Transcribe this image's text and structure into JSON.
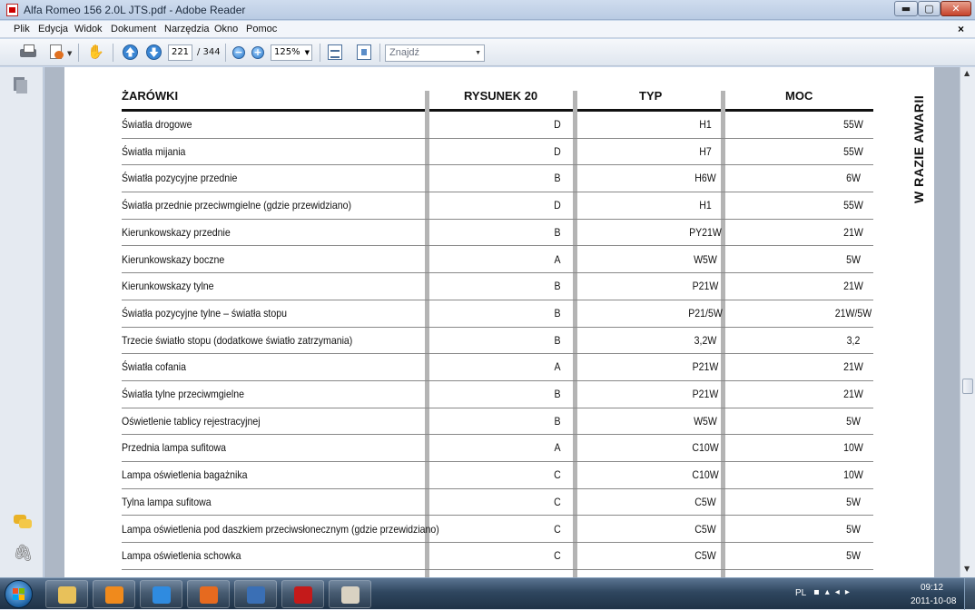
{
  "window": {
    "title": "Alfa Romeo 156 2.0L JTS.pdf - Adobe Reader",
    "minimize_label": "▬",
    "maximize_label": "▢",
    "close_label": "✕"
  },
  "menu": {
    "items": [
      "Plik",
      "Edycja",
      "Widok",
      "Dokument",
      "Narzędzia",
      "Okno",
      "Pomoc"
    ],
    "doc_close": "×"
  },
  "toolbar": {
    "current_page": "221",
    "total_pages": "/ 344",
    "zoom": "125%",
    "find_placeholder": "Znajdź"
  },
  "document": {
    "side_title": "W RAZIE AWARII",
    "table": {
      "headers": [
        "ŻARÓWKI",
        "RYSUNEK 20",
        "TYP",
        "MOC"
      ],
      "rows": [
        [
          "Światła drogowe",
          "D",
          "H1",
          "55W"
        ],
        [
          "Światła mijania",
          "D",
          "H7",
          "55W"
        ],
        [
          "Światła pozycyjne przednie",
          "B",
          "H6W",
          "6W"
        ],
        [
          "Światła przednie przeciwmgielne (gdzie przewidziano)",
          "D",
          "H1",
          "55W"
        ],
        [
          "Kierunkowskazy przednie",
          "B",
          "PY21W",
          "21W"
        ],
        [
          "Kierunkowskazy boczne",
          "A",
          "W5W",
          "5W"
        ],
        [
          "Kierunkowskazy tylne",
          "B",
          "P21W",
          "21W"
        ],
        [
          "Światła pozycyjne tylne – światła stopu",
          "B",
          "P21/5W",
          "21W/5W"
        ],
        [
          "Trzecie światło stopu (dodatkowe światło zatrzymania)",
          "B",
          "3,2W",
          "3,2"
        ],
        [
          "Światła cofania",
          "A",
          "P21W",
          "21W"
        ],
        [
          "Światła tylne przeciwmgielne",
          "B",
          "P21W",
          "21W"
        ],
        [
          "Oświetlenie tablicy rejestracyjnej",
          "B",
          "W5W",
          "5W"
        ],
        [
          "Przednia lampa sufitowa",
          "A",
          "C10W",
          "10W"
        ],
        [
          "Lampa oświetlenia bagażnika",
          "C",
          "C10W",
          "10W"
        ],
        [
          "Tylna lampa sufitowa",
          "C",
          "C5W",
          "5W"
        ],
        [
          "Lampa oświetlenia pod daszkiem przeciwsłonecznym (gdzie przewidziano)",
          "C",
          "C5W",
          "5W"
        ],
        [
          "Lampa oświetlenia schowka",
          "C",
          "C5W",
          "5W"
        ]
      ]
    }
  },
  "taskbar": {
    "apps": [
      {
        "name": "explorer",
        "color": "#e8c15a"
      },
      {
        "name": "media-player",
        "color": "#f08a1c"
      },
      {
        "name": "internet-explorer",
        "color": "#2f8be0"
      },
      {
        "name": "firefox",
        "color": "#e66a1f"
      },
      {
        "name": "thunderbird",
        "color": "#3a6fb5"
      },
      {
        "name": "adobe-reader",
        "color": "#c41a1a"
      },
      {
        "name": "paint",
        "color": "#d9d2c2"
      }
    ],
    "language": "PL",
    "time": "09:12",
    "date": "2011-10-08"
  }
}
